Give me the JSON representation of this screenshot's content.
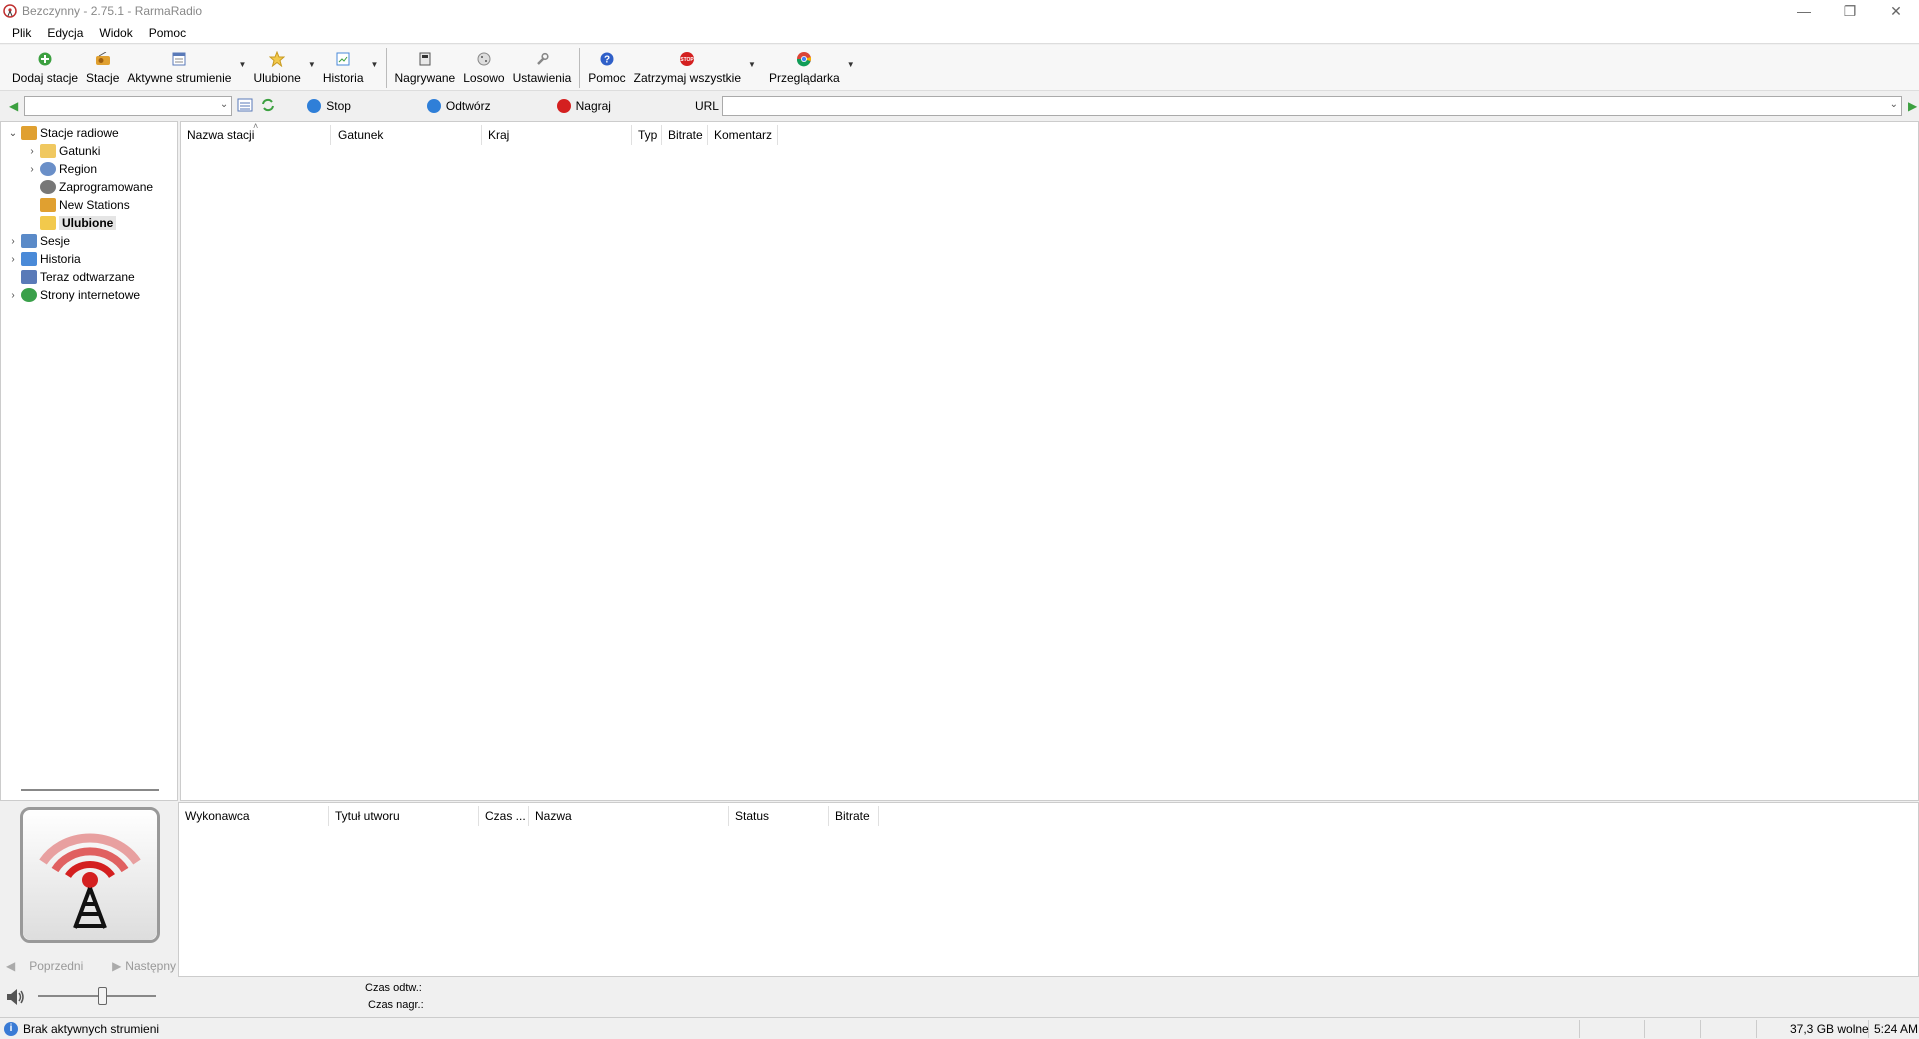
{
  "window": {
    "title": "Bezczynny - 2.75.1 - RarmaRadio",
    "minimize": "—",
    "maximize": "❐",
    "close": "✕"
  },
  "menu": [
    "Plik",
    "Edycja",
    "Widok",
    "Pomoc"
  ],
  "toolbar": {
    "add_station": "Dodaj stacje",
    "stations": "Stacje",
    "active_streams": "Aktywne strumienie",
    "favorites": "Ulubione",
    "history": "Historia",
    "recorded": "Nagrywane",
    "random": "Losowo",
    "settings": "Ustawienia",
    "help": "Pomoc",
    "stop_all": "Zatrzymaj wszystkie",
    "browser": "Przeglądarka"
  },
  "controls": {
    "stop": "Stop",
    "play": "Odtwórz",
    "record": "Nagraj",
    "url_label": "URL"
  },
  "tree": {
    "items": [
      {
        "label": "Stacje radiowe",
        "expander": "⌄",
        "icon_color": "#e0a030"
      },
      {
        "label": "Gatunki",
        "expander": "›",
        "icon_color": "#f0c860"
      },
      {
        "label": "Region",
        "expander": "›",
        "icon_color": "#6a8fc8"
      },
      {
        "label": "Zaprogramowane",
        "expander": "",
        "icon_color": "#777777"
      },
      {
        "label": "New Stations",
        "expander": "",
        "icon_color": "#e0a030"
      },
      {
        "label": "Ulubione",
        "expander": "",
        "icon_color": "#f2c94c"
      },
      {
        "label": "Sesje",
        "expander": "›",
        "icon_color": "#5a8ac8"
      },
      {
        "label": "Historia",
        "expander": "›",
        "icon_color": "#4a8ad8"
      },
      {
        "label": "Teraz odtwarzane",
        "expander": "",
        "icon_color": "#5a7ab8"
      },
      {
        "label": "Strony internetowe",
        "expander": "›",
        "icon_color": "#3aa04a"
      }
    ]
  },
  "station_columns": [
    "Nazwa stacji",
    "Gatunek",
    "Kraj",
    "Typ",
    "Bitrate",
    "Komentarz"
  ],
  "playlist_columns": [
    "Wykonawca",
    "Tytuł utworu",
    "Czas ...",
    "Nazwa",
    "Status",
    "Bitrate"
  ],
  "nav": {
    "prev": "Poprzedni",
    "next": "Następny"
  },
  "times": {
    "play_label": "Czas odtw.:",
    "rec_label": "Czas nagr.:"
  },
  "volume": {
    "level": 0.55
  },
  "status": {
    "message": "Brak aktywnych strumieni",
    "disk": "37,3 GB wolne",
    "time": "5:24 AM"
  },
  "colors": {
    "accent_blue": "#2f7fd8",
    "record_red": "#d42020",
    "play_green": "#3ca040"
  }
}
